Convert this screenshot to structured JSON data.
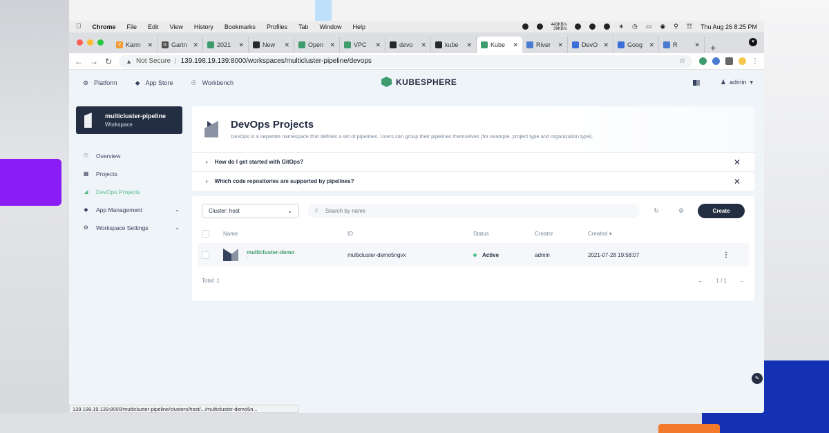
{
  "menubar": {
    "app": "Chrome",
    "items": [
      "File",
      "Edit",
      "View",
      "History",
      "Bookmarks",
      "Profiles",
      "Tab",
      "Window",
      "Help"
    ],
    "net_up": "443KB/s",
    "net_down": "39KB/s",
    "clock": "Thu Aug 26  8:25 PM"
  },
  "browser": {
    "tabs": [
      {
        "label": "Karm",
        "color": "#f39b33",
        "glyph": "Y"
      },
      {
        "label": "Gartn",
        "color": "#4b4b4b",
        "glyph": "G"
      },
      {
        "label": "2021",
        "color": "#3e9b6d",
        "glyph": ""
      },
      {
        "label": "New",
        "color": "#24292e",
        "glyph": ""
      },
      {
        "label": "Open",
        "color": "#3e9b6d",
        "glyph": ""
      },
      {
        "label": "VPC",
        "color": "#3e9b6d",
        "glyph": ""
      },
      {
        "label": "devo",
        "color": "#24292e",
        "glyph": ""
      },
      {
        "label": "kube",
        "color": "#24292e",
        "glyph": ""
      },
      {
        "label": "Kube",
        "color": "#3e9b6d",
        "glyph": ""
      },
      {
        "label": "River",
        "color": "#4a7bd0",
        "glyph": ""
      },
      {
        "label": "DevO",
        "color": "#3b6fd8",
        "glyph": ""
      },
      {
        "label": "Goog",
        "color": "#3b6fd8",
        "glyph": ""
      },
      {
        "label": "R",
        "color": "#4a7bd0",
        "glyph": ""
      }
    ],
    "active_tab_index": 8,
    "not_secure": "Not Secure",
    "url": "139.198.19.139:8000/workspaces/multicluster-pipeline/devops",
    "status_url": "139.198.19.139:8000/multicluster-pipeline/clusters/host/.../multicluster-demo5n..."
  },
  "header": {
    "nav": [
      "Platform",
      "App Store",
      "Workbench"
    ],
    "logo": "KUBESPHERE",
    "user": "admin"
  },
  "workspace": {
    "name": "multicluster-pipeline",
    "type": "Workspace"
  },
  "sidebar": {
    "items": [
      {
        "label": "Overview",
        "icon": "dashboard-icon"
      },
      {
        "label": "Projects",
        "icon": "projects-icon"
      },
      {
        "label": "DevOps Projects",
        "icon": "devops-icon"
      },
      {
        "label": "App Management",
        "icon": "app-icon"
      },
      {
        "label": "Workspace Settings",
        "icon": "gear-icon"
      }
    ]
  },
  "banner": {
    "title": "DevOps Projects",
    "description": "DevOps is a separate namespace that defines a set of pipelines. Users can group their pipelines themselves (for example, project type and organization type)."
  },
  "faq": [
    "How do I get started with GitOps?",
    "Which code repositories are supported by pipelines?"
  ],
  "filters": {
    "cluster": "Cluster: host",
    "search_placeholder": "Search by name",
    "create_label": "Create"
  },
  "table": {
    "columns": {
      "name": "Name",
      "id": "ID",
      "status": "Status",
      "creator": "Creator",
      "created": "Created"
    },
    "rows": [
      {
        "name": "multicluster-demo",
        "desc": "-",
        "id": "multicluster-demo5ngvx",
        "status": "Active",
        "creator": "admin",
        "created": "2021-07-28 19:58:07"
      }
    ],
    "total": "Total: 1",
    "page": "1 / 1"
  }
}
